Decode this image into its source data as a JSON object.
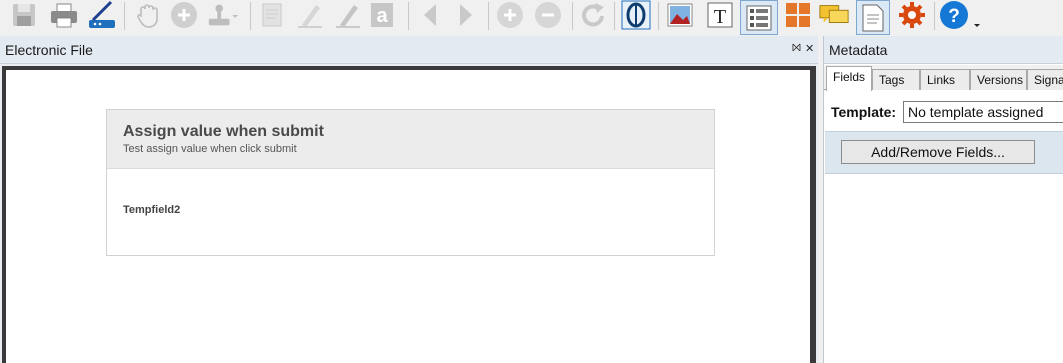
{
  "toolbar": {
    "icons": [
      "save-icon",
      "print-icon",
      "scanner-icon",
      "pan-hand-icon",
      "zoom-in-icon",
      "stamp-icon",
      "note-icon",
      "highlighter-icon",
      "marker-icon",
      "text-icon",
      "previous-page-icon",
      "next-page-icon",
      "zoom-plus-icon",
      "zoom-minus-icon",
      "rotate-icon",
      "ocr-icon",
      "image-icon",
      "text-tool-icon",
      "field-list-icon",
      "thumbnails-icon",
      "comments-icon",
      "document-icon",
      "settings-icon",
      "help-icon"
    ],
    "colors": {
      "disabled": "#b9b9b9",
      "accent": "#1f6fbf",
      "help": "#1478d4",
      "settings": "#d9480f",
      "thumbnails": "#e5772b"
    }
  },
  "left_pane": {
    "title": "Electronic File",
    "pin_glyph": "⨝",
    "close_glyph": "✕",
    "form": {
      "title": "Assign value when submit",
      "subtitle": "Test assign value when click submit",
      "field_label": "Tempfield2"
    }
  },
  "right_pane": {
    "title": "Metadata",
    "tabs": [
      "Fields",
      "Tags",
      "Links",
      "Versions",
      "Signat"
    ],
    "active_tab": "Fields",
    "template_label": "Template:",
    "template_value": "No template assigned",
    "add_remove_button": "Add/Remove Fields..."
  }
}
